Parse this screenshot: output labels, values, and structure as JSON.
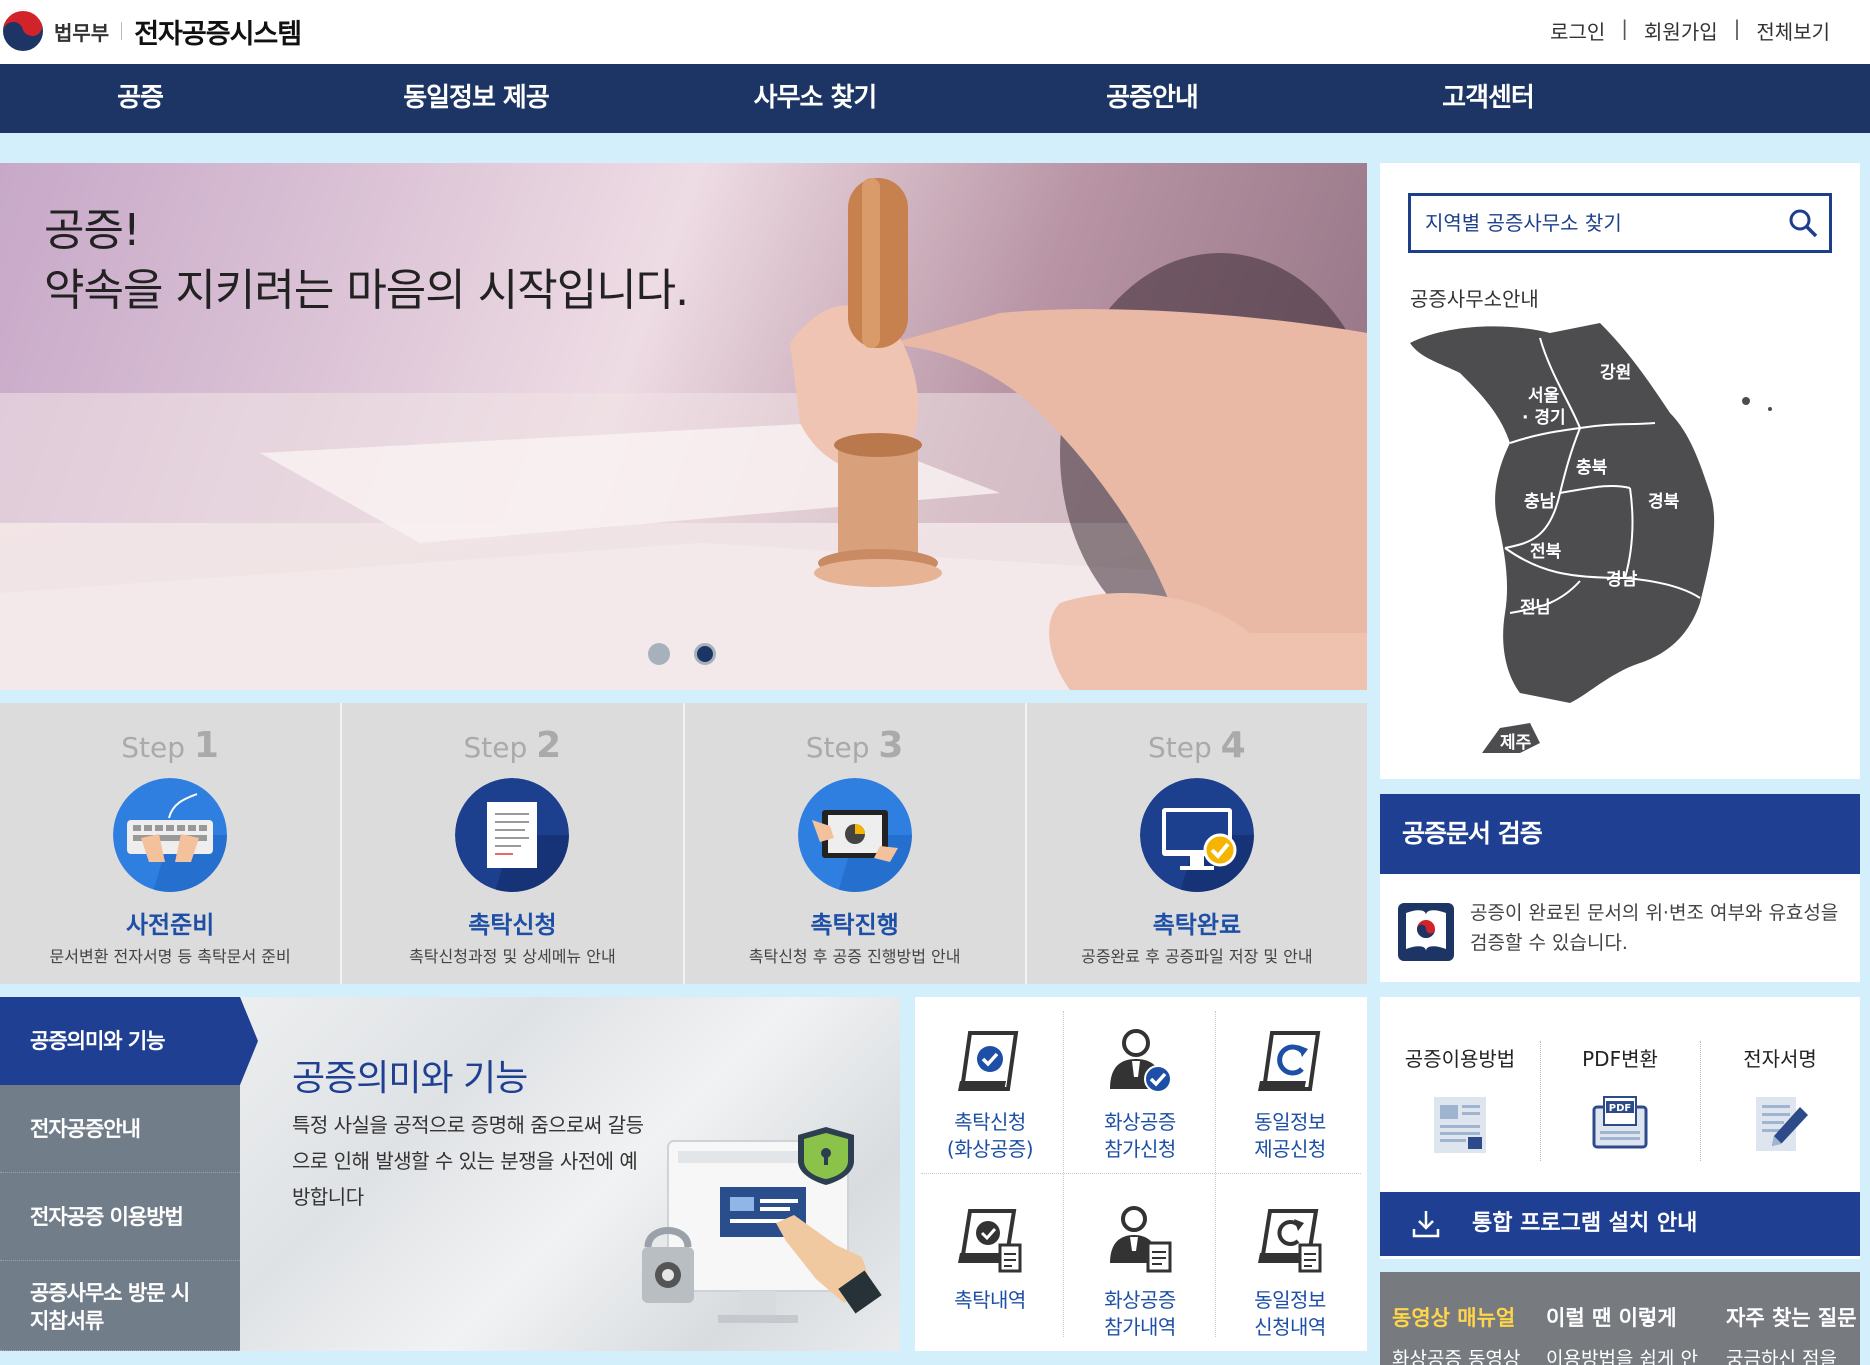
{
  "header": {
    "ministry": "법무부",
    "system_name": "전자공증시스템",
    "util_links": [
      "로그인",
      "회원가입",
      "전체보기"
    ]
  },
  "nav": [
    "공증",
    "동일정보 제공",
    "사무소 찾기",
    "공증안내",
    "고객센터"
  ],
  "hero": {
    "line1": "공증!",
    "line2": "약속을 지키려는 마음의 시작입니다.",
    "active_slide": 2,
    "slide_count": 2
  },
  "steps": [
    {
      "prefix": "Step",
      "num": "1",
      "title": "사전준비",
      "desc": "문서변환 전자서명 등 촉탁문서 준비",
      "icon": "keyboard-icon"
    },
    {
      "prefix": "Step",
      "num": "2",
      "title": "촉탁신청",
      "desc": "촉탁신청과정 및 상세메뉴 안내",
      "icon": "document-icon"
    },
    {
      "prefix": "Step",
      "num": "3",
      "title": "촉탁진행",
      "desc": "촉탁신청 후 공증 진행방법 안내",
      "icon": "tablet-icon"
    },
    {
      "prefix": "Step",
      "num": "4",
      "title": "촉탁완료",
      "desc": "공증완료 후 공증파일 저장 및 안내",
      "icon": "monitor-check-icon"
    }
  ],
  "finder": {
    "placeholder": "지역별 공증사무소 찾기",
    "subtitle": "공증사무소안내",
    "regions": [
      "강원",
      "서울",
      "· 경기",
      "충북",
      "충남",
      "경북",
      "전북",
      "경남",
      "전남",
      "제주"
    ]
  },
  "verify": {
    "title": "공증문서 검증",
    "text": "공증이 완료된 문서의 위·변조 여부와 유효성을 검증할 수 있습니다."
  },
  "tools": [
    "공증이용방법",
    "PDF변환",
    "전자서명"
  ],
  "install_label": "통합 프로그램 설치 안내",
  "bottom_tabs": [
    {
      "label": "동영상 매뉴얼",
      "sub": "화상공증 동영상"
    },
    {
      "label": "이럴 땐 이렇게",
      "sub": "이용방법을 쉽게 안"
    },
    {
      "label": "자주 찾는 질문",
      "sub": "궁금하신 점을"
    }
  ],
  "intro": {
    "menu": [
      "공증의미와 기능",
      "전자공증안내",
      "전자공증 이용방법",
      "공증사무소 방문 시",
      "지참서류"
    ],
    "title": "공증의미와 기능",
    "desc": "특정 사실을 공적으로 증명해 줌으로써 갈등으로 인해 발생할 수 있는 분쟁을 사전에 예방합니다"
  },
  "services": [
    {
      "line1": "촉탁신청",
      "line2": "(화상공증)",
      "icon": "apply-icon"
    },
    {
      "line1": "화상공증",
      "line2": "참가신청",
      "icon": "person-check-icon"
    },
    {
      "line1": "동일정보",
      "line2": "제공신청",
      "icon": "copy-icon"
    },
    {
      "line1": "촉탁내역",
      "line2": "",
      "icon": "apply-history-icon"
    },
    {
      "line1": "화상공증",
      "line2": "참가내역",
      "icon": "person-doc-icon"
    },
    {
      "line1": "동일정보",
      "line2": "신청내역",
      "icon": "copy-history-icon"
    }
  ],
  "colors": {
    "nav_bg": "#1c3564",
    "accent_blue": "#1f3f92",
    "step_title": "#1d4fa6",
    "page_bg": "#d3effb",
    "highlight": "#ffd54a"
  }
}
